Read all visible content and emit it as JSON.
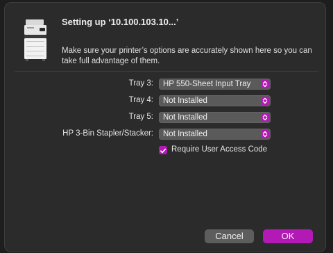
{
  "dialog": {
    "title": "Setting up ‘10.100.103.10...’",
    "description": "Make sure your printer’s options are accurately shown here so you can take full advantage of them."
  },
  "options": [
    {
      "label": "Tray 3:",
      "value": "HP 550-Sheet Input Tray"
    },
    {
      "label": "Tray 4:",
      "value": "Not Installed"
    },
    {
      "label": "Tray 5:",
      "value": "Not Installed"
    },
    {
      "label": "HP 3-Bin Stapler/Stacker:",
      "value": "Not Installed"
    }
  ],
  "checkbox": {
    "label": "Require User Access Code",
    "checked": true
  },
  "buttons": {
    "cancel": "Cancel",
    "ok": "OK"
  },
  "colors": {
    "accent": "#b31ab5",
    "background": "#2b2b2b"
  }
}
